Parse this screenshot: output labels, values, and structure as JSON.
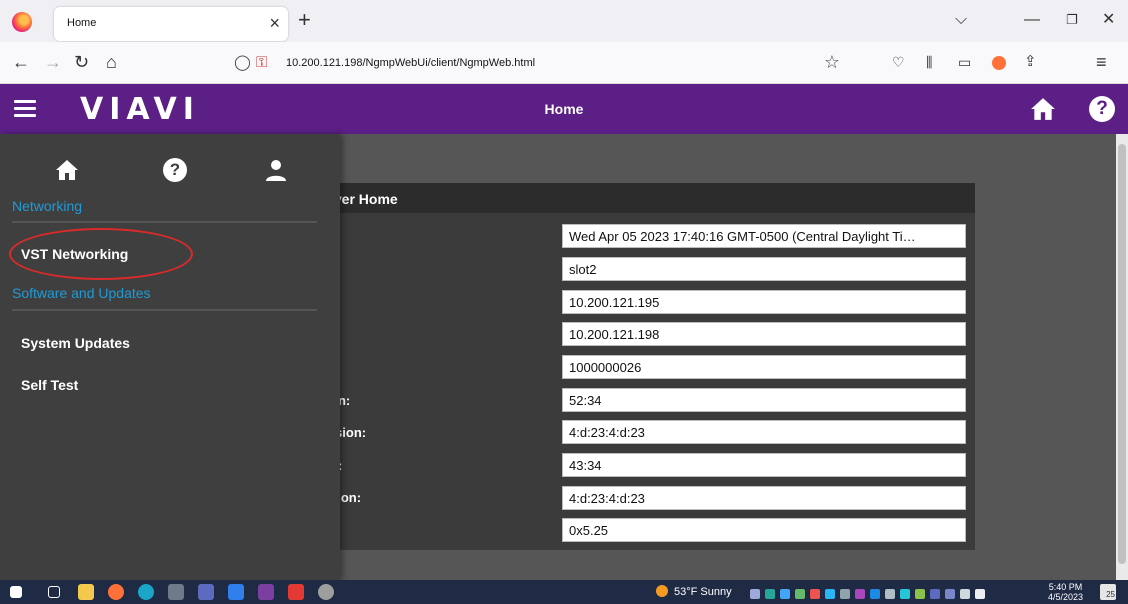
{
  "browser": {
    "tab_title": "Home",
    "url": "10.200.121.198/NgmpWebUi/client/NgmpWeb.html"
  },
  "app": {
    "logo": "VIAVI",
    "title": "Home",
    "brand_color": "#5b1f86"
  },
  "drawer": {
    "section_networking": "Networking",
    "item_vst_networking": "VST Networking",
    "section_software": "Software and Updates",
    "item_system_updates": "System Updates",
    "item_self_test": "Self Test",
    "accent_color": "#1e9bd7"
  },
  "card": {
    "title_visible": "iver Home",
    "labels_visible": [
      "on:",
      "rsion:",
      "n:",
      "sion:"
    ],
    "values": [
      "Wed Apr 05 2023 17:40:16 GMT-0500 (Central Daylight Ti…",
      "slot2",
      "10.200.121.195",
      "10.200.121.198",
      "1000000026",
      "52:34",
      "4:d:23:4:d:23",
      "43:34",
      "4:d:23:4:d:23",
      "0x5.25"
    ]
  },
  "taskbar": {
    "weather": "53°F Sunny",
    "time": "5:40 PM",
    "date": "4/5/2023",
    "notification_count": "25"
  }
}
